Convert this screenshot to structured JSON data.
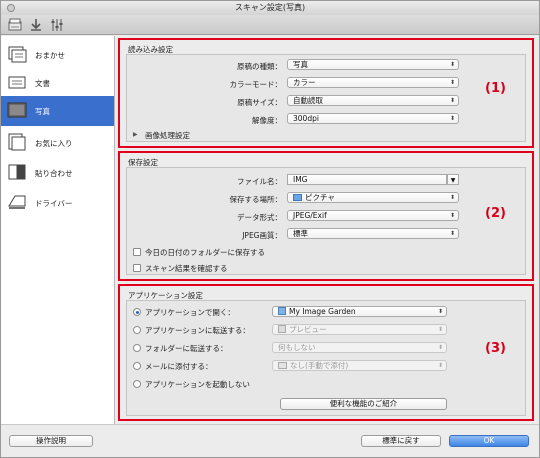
{
  "window": {
    "title": "スキャン設定(写真)"
  },
  "toolbar": {
    "icons": [
      "scanner-icon",
      "download-icon",
      "settings-sliders-icon"
    ]
  },
  "sidebar": {
    "items": [
      {
        "label": "おまかせ",
        "icon": "auto-scan-icon"
      },
      {
        "label": "文書",
        "icon": "document-icon"
      },
      {
        "label": "写真",
        "icon": "photo-icon",
        "selected": true
      },
      {
        "label": "お気に入り",
        "icon": "favorite-icon"
      },
      {
        "label": "貼り合わせ",
        "icon": "stitch-icon"
      },
      {
        "label": "ドライバー",
        "icon": "driver-icon"
      }
    ]
  },
  "scan_settings": {
    "title": "読み込み設定",
    "badge": "(1)",
    "doc_type": {
      "label": "原稿の種類：",
      "value": "写真"
    },
    "color_mode": {
      "label": "カラーモード：",
      "value": "カラー"
    },
    "paper_size": {
      "label": "原稿サイズ：",
      "value": "自動読取"
    },
    "resolution": {
      "label": "解像度：",
      "value": "300dpi"
    },
    "image_processing": "画像処理設定"
  },
  "save_settings": {
    "title": "保存設定",
    "badge": "(2)",
    "file_name": {
      "label": "ファイル名：",
      "value": "IMG"
    },
    "save_in": {
      "label": "保存する場所：",
      "value": "ピクチャ"
    },
    "data_format": {
      "label": "データ形式：",
      "value": "JPEG/Exif"
    },
    "jpeg_quality": {
      "label": "JPEG画質：",
      "value": "標準"
    },
    "save_date_folder": "今日の日付のフォルダーに保存する",
    "check_result": "スキャン結果を確認する"
  },
  "app_settings": {
    "title": "アプリケーション設定",
    "badge": "(3)",
    "open_with": {
      "label": "アプリケーションで開く：",
      "value": "My Image Garden"
    },
    "send_to_app": {
      "label": "アプリケーションに転送する：",
      "value": "プレビュー"
    },
    "send_to_folder": {
      "label": "フォルダーに転送する：",
      "value": "何もしない"
    },
    "attach_email": {
      "label": "メールに添付する：",
      "value": "なし(手動で添付)"
    },
    "no_launch": "アプリケーションを起動しない",
    "features_button": "便利な機能のご紹介"
  },
  "footer": {
    "instructions": "操作説明",
    "defaults": "標準に戻す",
    "ok": "OK"
  },
  "colors": {
    "highlight_red": "#e0001b",
    "sidebar_selected": "#3a6fcd"
  }
}
